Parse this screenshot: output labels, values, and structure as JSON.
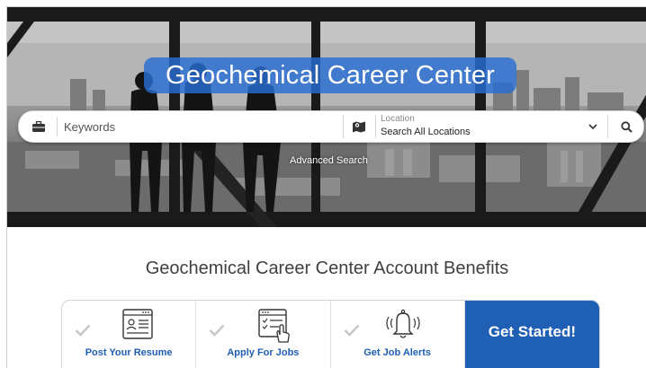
{
  "hero": {
    "title": "Geochemical Career Center",
    "accent_color": "#2b6fd1"
  },
  "search": {
    "keywords_placeholder": "Keywords",
    "location_caption": "Location",
    "location_value": "Search All Locations",
    "keyword_icon": "briefcase-icon",
    "location_icon": "map-icon",
    "dropdown_icon": "chevron-down-icon",
    "search_icon": "magnifier-icon"
  },
  "advanced_search": "Advanced Search",
  "benefits": {
    "title": "Geochemical Career Center Account Benefits",
    "items": [
      {
        "label": "Post Your Resume",
        "icon": "resume-icon"
      },
      {
        "label": "Apply For Jobs",
        "icon": "application-icon"
      },
      {
        "label": "Get Job Alerts",
        "icon": "bell-icon"
      }
    ],
    "cta": "Get Started!",
    "link_color": "#1f5fb4",
    "check_color": "#c8c8c8"
  }
}
